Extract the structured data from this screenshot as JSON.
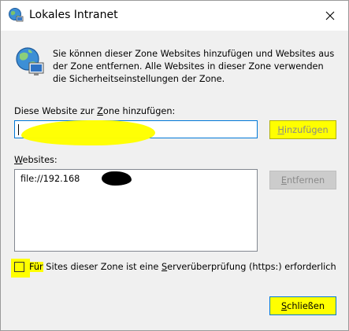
{
  "window": {
    "title": "Lokales Intranet",
    "close_glyph": "✕"
  },
  "description": {
    "line1": "Sie können dieser Zone Websites hinzufügen und Websites aus",
    "line2": "der Zone entfernen. Alle Websites in dieser Zone verwenden",
    "line3": "die Sicherheitseinstellungen der Zone."
  },
  "add_site": {
    "label_pre": "Diese Website zur ",
    "label_accel": "Z",
    "label_post": "one hinzufügen:",
    "value": "",
    "button_accel": "H",
    "button_rest": "inzufügen"
  },
  "websites": {
    "label_accel": "W",
    "label_rest": "ebsites:",
    "items": [
      "file://192.168"
    ],
    "remove_accel": "E",
    "remove_rest": "ntfernen"
  },
  "https_check": {
    "checked": false,
    "label_hl": "Für",
    "label_mid": " Sites dieser Zone ist eine ",
    "label_accel": "S",
    "label_post": "erverüberprüfung (https:) erforderlich"
  },
  "close_button": {
    "accel": "S",
    "rest": "chließen"
  },
  "colors": {
    "highlight": "#ffff00",
    "focus_border": "#0078d7",
    "dialog_bg": "#f0f0f0"
  },
  "icons": {
    "title": "globe-network-icon",
    "content": "globe-computer-icon"
  }
}
